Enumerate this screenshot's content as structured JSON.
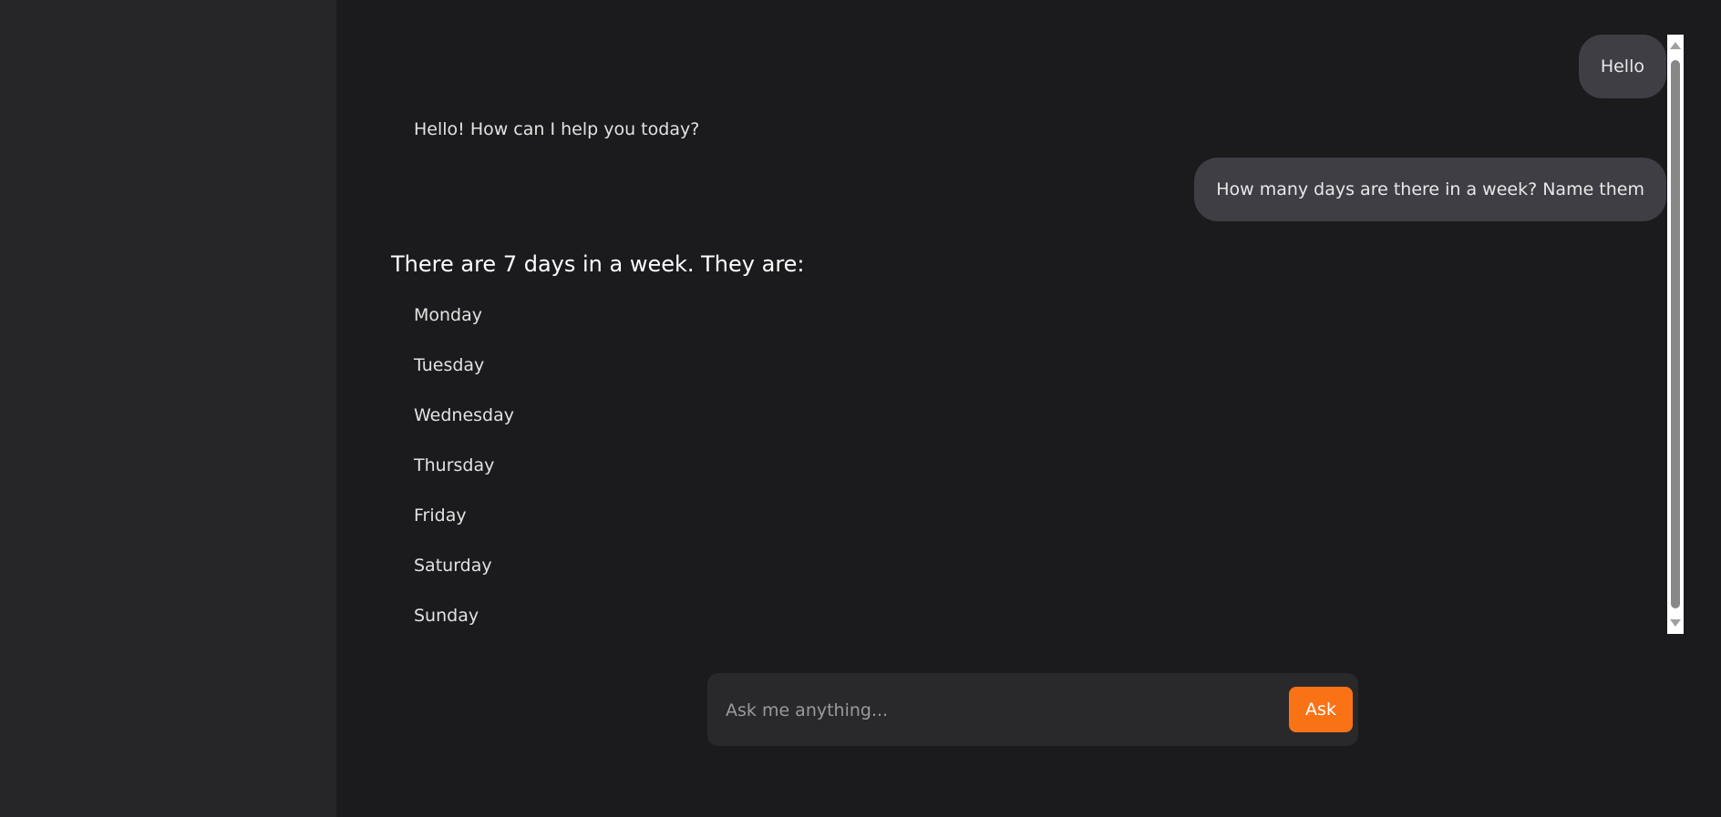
{
  "conversation": {
    "messages": [
      {
        "role": "user",
        "text": "Hello"
      },
      {
        "role": "assistant",
        "text": "Hello! How can I help you today?"
      },
      {
        "role": "user",
        "text": "How many days are there in a week? Name them"
      },
      {
        "role": "assistant",
        "heading": "There are 7 days in a week. They are:",
        "items": [
          "Monday",
          "Tuesday",
          "Wednesday",
          "Thursday",
          "Friday",
          "Saturday",
          "Sunday"
        ]
      }
    ]
  },
  "composer": {
    "placeholder": "Ask me anything...",
    "value": "",
    "submit_label": "Ask"
  },
  "colors": {
    "accent": "#f97316",
    "background": "#1b1b1e",
    "sidebar": "#262628",
    "user_bubble": "#3e3e44"
  }
}
